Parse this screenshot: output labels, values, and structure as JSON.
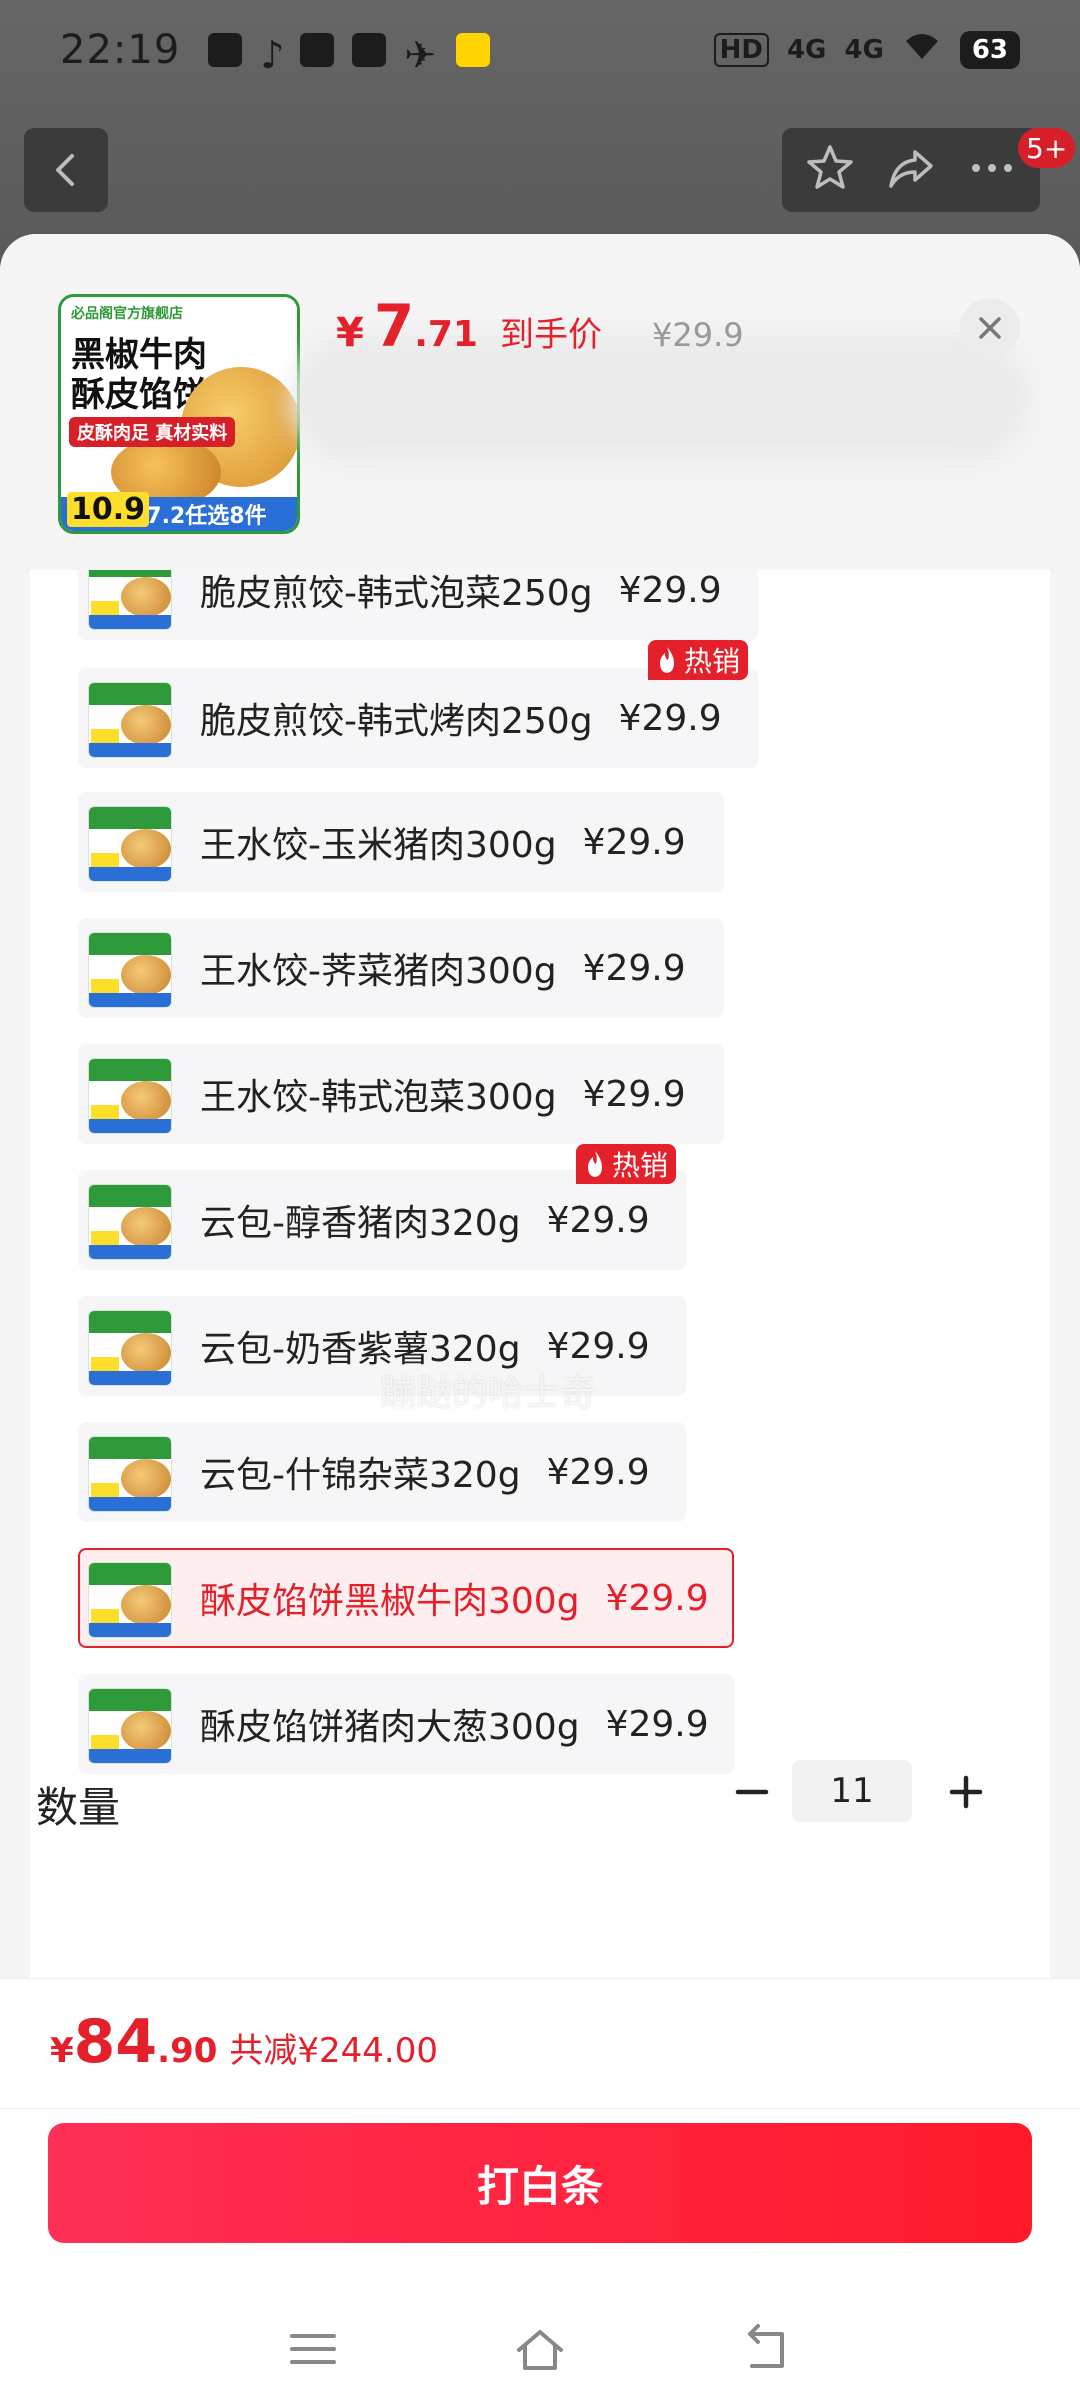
{
  "status_bar": {
    "time": "22:19",
    "signal_a": "4G",
    "signal_b": "4G",
    "hd": "HD",
    "battery": "63"
  },
  "nav": {
    "badge": "5+"
  },
  "header": {
    "currency": "¥",
    "price_int": "7",
    "price_dec": ".71",
    "price_label": "到手价",
    "original_price": "¥29.9",
    "thumb": {
      "shop": "必品阁官方旗舰店",
      "title": "黑椒牛肉酥皮馅饼",
      "tag": "皮酥肉足 真材实料",
      "price": "10.9",
      "promo": "87.2任选8件"
    }
  },
  "options": [
    {
      "name": "脆皮煎饺-韩式泡菜250g",
      "price": "¥29.9",
      "hot": false,
      "selected": false
    },
    {
      "name": "脆皮煎饺-韩式烤肉250g",
      "price": "¥29.9",
      "hot": true,
      "selected": false
    },
    {
      "name": "王水饺-玉米猪肉300g",
      "price": "¥29.9",
      "hot": false,
      "selected": false
    },
    {
      "name": "王水饺-荠菜猪肉300g",
      "price": "¥29.9",
      "hot": false,
      "selected": false
    },
    {
      "name": "王水饺-韩式泡菜300g",
      "price": "¥29.9",
      "hot": false,
      "selected": false
    },
    {
      "name": "云包-醇香猪肉320g",
      "price": "¥29.9",
      "hot": true,
      "selected": false
    },
    {
      "name": "云包-奶香紫薯320g",
      "price": "¥29.9",
      "hot": false,
      "selected": false
    },
    {
      "name": "云包-什锦杂菜320g",
      "price": "¥29.9",
      "hot": false,
      "selected": false
    },
    {
      "name": "酥皮馅饼黑椒牛肉300g",
      "price": "¥29.9",
      "hot": false,
      "selected": true
    },
    {
      "name": "酥皮馅饼猪肉大葱300g",
      "price": "¥29.9",
      "hot": false,
      "selected": false
    }
  ],
  "hot_label": "热销",
  "watermark": "蹦跶的哈士奇",
  "quantity": {
    "label": "数量",
    "value": "11"
  },
  "total": {
    "currency": "¥",
    "int": "84",
    "dec": ".90",
    "saving": "共减¥244.00"
  },
  "pay_button": "打白条",
  "colors": {
    "accent": "#e4202a",
    "button_gradient_start": "#ff2f57",
    "button_gradient_end": "#ff1a2a"
  }
}
